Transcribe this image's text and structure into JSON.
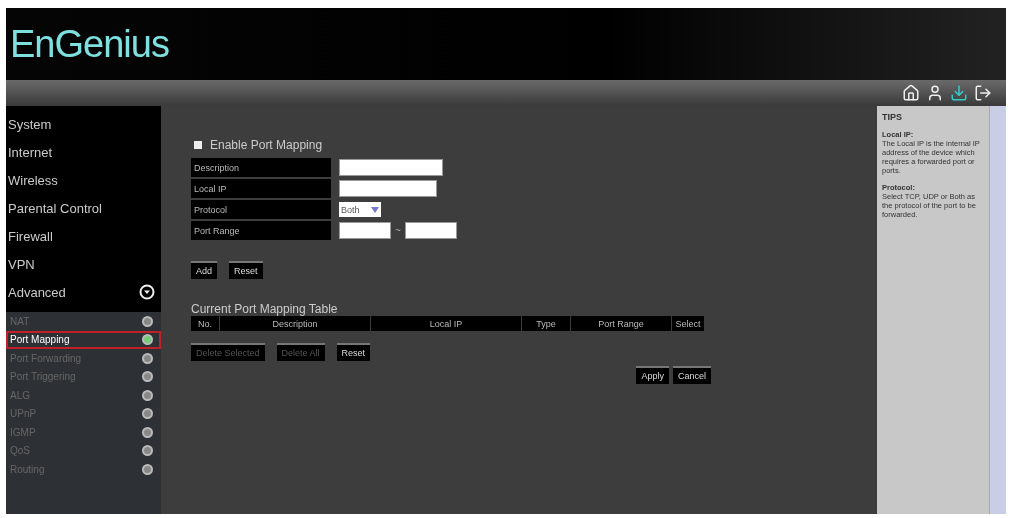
{
  "brand": "EnGenius",
  "sidebar": {
    "items": [
      {
        "label": "System"
      },
      {
        "label": "Internet"
      },
      {
        "label": "Wireless"
      },
      {
        "label": "Parental Control"
      },
      {
        "label": "Firewall"
      },
      {
        "label": "VPN"
      },
      {
        "label": "Advanced",
        "expanded": true,
        "children": [
          {
            "label": "NAT",
            "selected": false
          },
          {
            "label": "Port Mapping",
            "selected": true
          },
          {
            "label": "Port Forwarding",
            "selected": false
          },
          {
            "label": "Port Triggering",
            "selected": false
          },
          {
            "label": "ALG",
            "selected": false
          },
          {
            "label": "UPnP",
            "selected": false
          },
          {
            "label": "IGMP",
            "selected": false
          },
          {
            "label": "QoS",
            "selected": false
          },
          {
            "label": "Routing",
            "selected": false
          }
        ]
      }
    ]
  },
  "enable": {
    "label": "Enable Port Mapping",
    "checked": false
  },
  "form": [
    {
      "label": "Description",
      "kind": "text"
    },
    {
      "label": "Local IP",
      "kind": "text"
    },
    {
      "label": "Protocol",
      "kind": "select",
      "value": "Both"
    },
    {
      "label": "Port Range",
      "kind": "range",
      "separator": "~"
    }
  ],
  "form_buttons": [
    "Add",
    "Reset"
  ],
  "table": {
    "title": "Current Port Mapping Table",
    "columns": [
      "No.",
      "Description",
      "Local IP",
      "Type",
      "Port Range",
      "Select"
    ]
  },
  "table_buttons": [
    {
      "label": "Delete Selected",
      "disabled": true
    },
    {
      "label": "Delete All",
      "disabled": true
    },
    {
      "label": "Reset",
      "disabled": false
    }
  ],
  "actions": [
    "Apply",
    "Cancel"
  ],
  "tips": {
    "title": "TIPS",
    "sections": [
      {
        "heading": "Local IP:",
        "text": "The Local IP is the internal IP address of the device which requires a forwarded port or ports."
      },
      {
        "heading": "Protocol:",
        "text": "Select TCP, UDP or Both as the protocol of the port to be forwarded."
      }
    ]
  }
}
